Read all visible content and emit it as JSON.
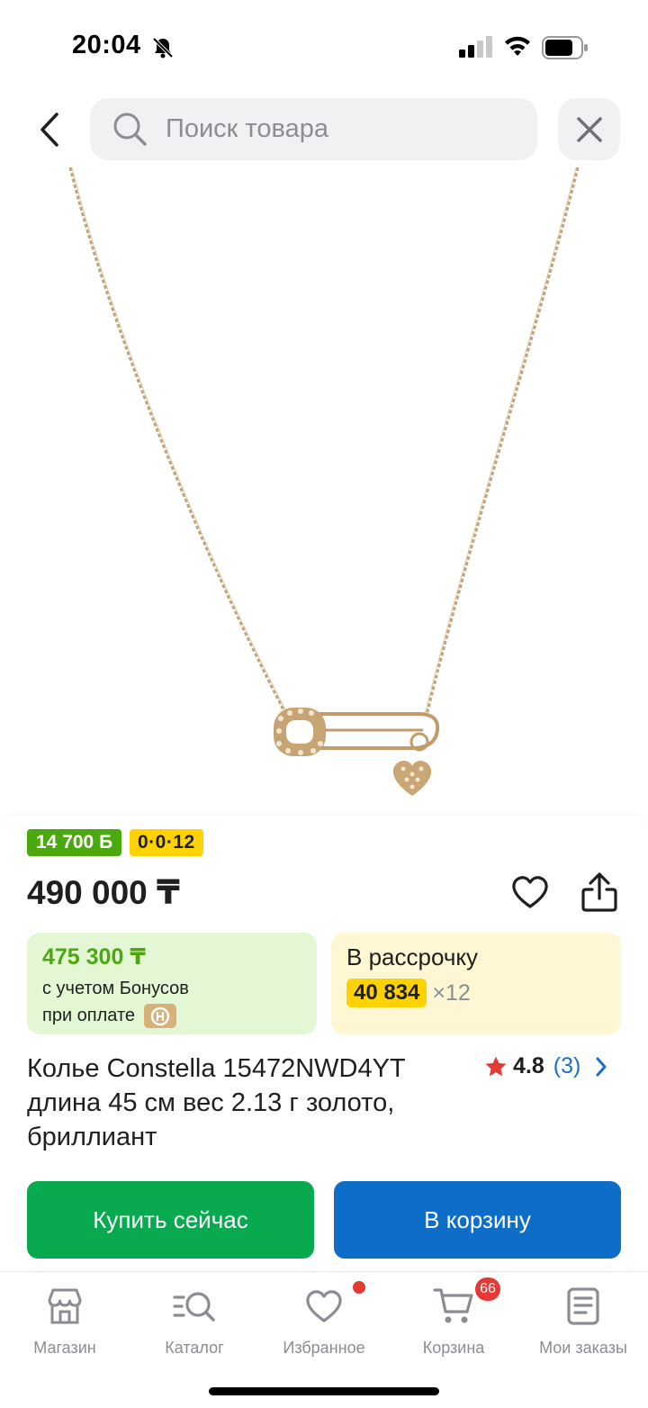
{
  "status_bar": {
    "time": "20:04"
  },
  "search": {
    "placeholder": "Поиск товара"
  },
  "product": {
    "bonus_badge": "14 700 Б",
    "installment_badge": "0·0·12",
    "price": "490 000 ₸",
    "bonus_card": {
      "price": "475 300 ₸",
      "line1": "с учетом Бонусов",
      "line2": "при оплате"
    },
    "installment_card": {
      "title": "В рассрочку",
      "amount": "40 834",
      "times": "×12"
    },
    "title": "Колье Constella 15472NWD4YT длина 45 см вес 2.13 г золото, бриллиант",
    "rating": {
      "value": "4.8",
      "count": "(3)"
    }
  },
  "actions": {
    "buy_now": "Купить сейчас",
    "add_to_cart": "В корзину"
  },
  "nav": {
    "items": [
      {
        "label": "Магазин",
        "icon": "store-icon"
      },
      {
        "label": "Каталог",
        "icon": "catalog-search-icon"
      },
      {
        "label": "Избранное",
        "icon": "heart-icon"
      },
      {
        "label": "Корзина",
        "icon": "cart-icon",
        "badge": "66"
      },
      {
        "label": "Мои заказы",
        "icon": "orders-icon"
      }
    ]
  },
  "colors": {
    "buy_button": "#09aa4f",
    "cart_button": "#0e6ec7",
    "bonus_green": "#4ba80e",
    "installment_yellow": "#ffd200",
    "rating_star": "#e53935",
    "badge_red": "#e53935"
  }
}
